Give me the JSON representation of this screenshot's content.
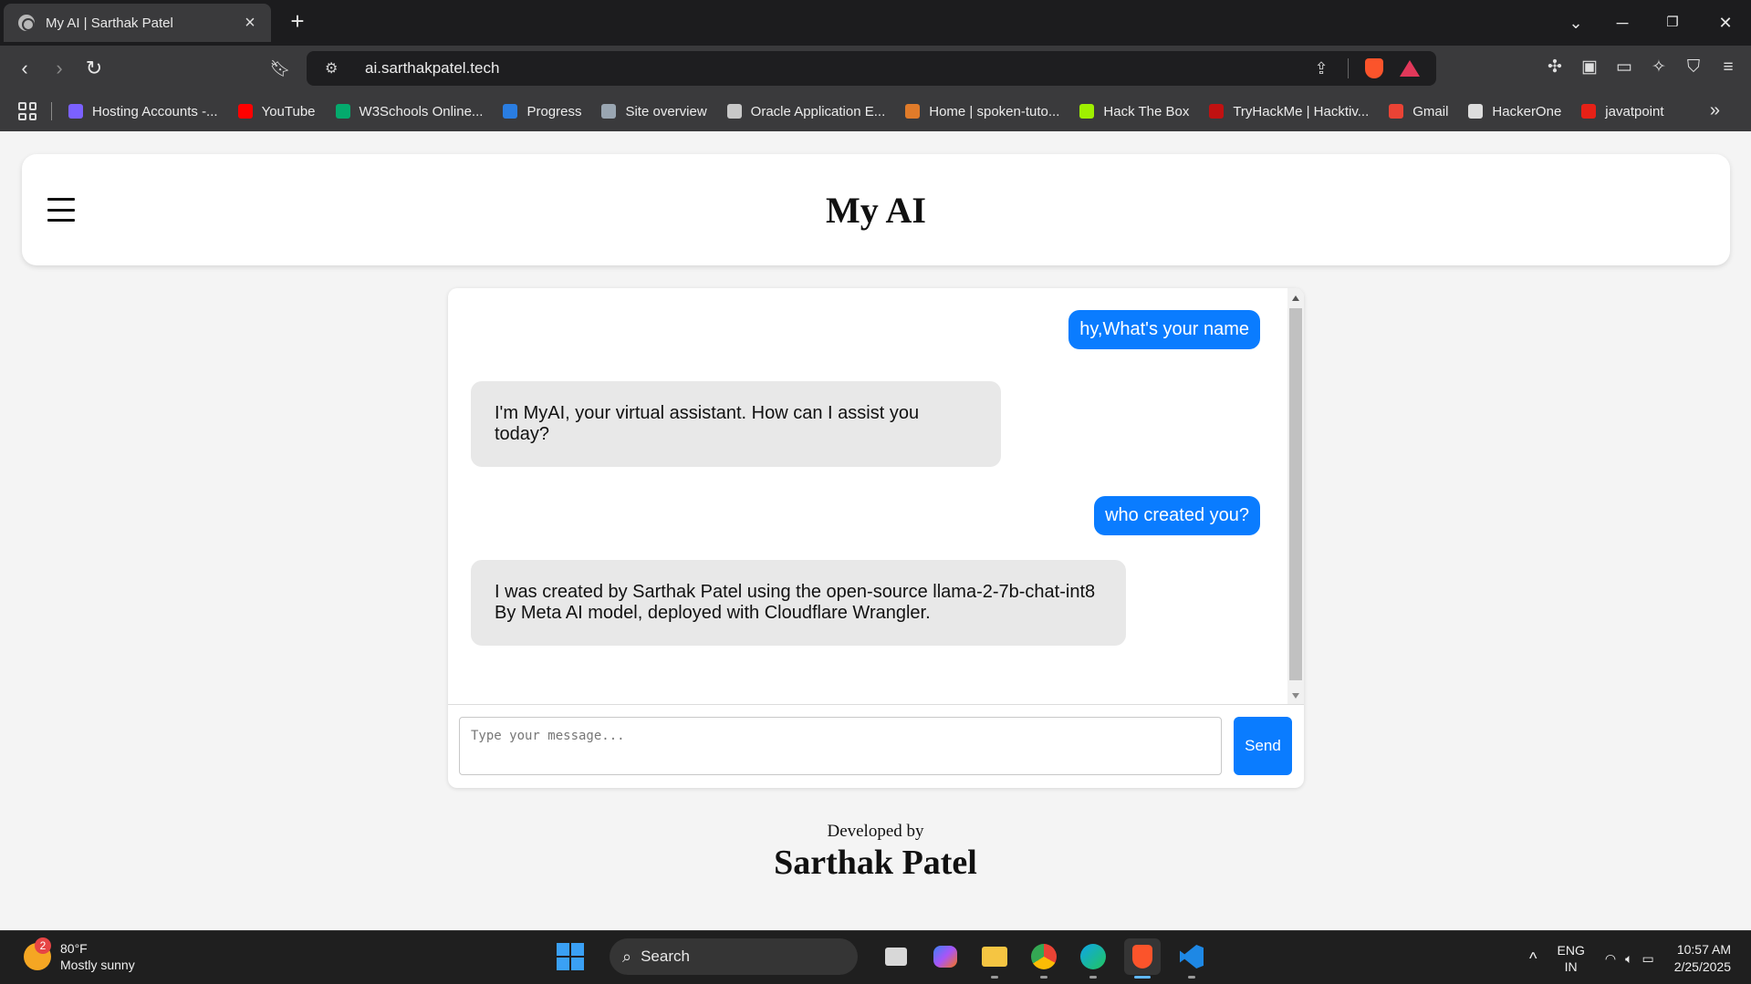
{
  "browser": {
    "tab_title": "My AI | Sarthak Patel",
    "url": "ai.sarthakpatel.tech",
    "bookmarks": [
      {
        "label": "Hosting Accounts -...",
        "color": "#7b61ff"
      },
      {
        "label": "YouTube",
        "color": "#ff0000"
      },
      {
        "label": "W3Schools Online...",
        "color": "#04aa6d"
      },
      {
        "label": "Progress",
        "color": "#2a7de1"
      },
      {
        "label": "Site overview",
        "color": "#9aa6b2"
      },
      {
        "label": "Oracle Application E...",
        "color": "#c8c8c8"
      },
      {
        "label": "Home | spoken-tuto...",
        "color": "#e07b2a"
      },
      {
        "label": "Hack The Box",
        "color": "#9fef00"
      },
      {
        "label": "TryHackMe | Hacktiv...",
        "color": "#c11111"
      },
      {
        "label": "Gmail",
        "color": "#ea4335"
      },
      {
        "label": "HackerOne",
        "color": "#dddddd"
      },
      {
        "label": "javatpoint",
        "color": "#e62117"
      }
    ]
  },
  "header": {
    "title": "My AI"
  },
  "chat": {
    "messages": [
      {
        "role": "user",
        "text": "hy,What's your name"
      },
      {
        "role": "bot",
        "text": "I'm MyAI, your virtual assistant. How can I assist you today?"
      },
      {
        "role": "user",
        "text": "who created you?"
      },
      {
        "role": "bot",
        "text": "I was created by Sarthak Patel using the open-source llama-2-7b-chat-int8 By Meta AI model, deployed with Cloudflare Wrangler."
      }
    ],
    "input_placeholder": "Type your message...",
    "send_label": "Send"
  },
  "footer": {
    "developed_by": "Developed by",
    "developer": "Sarthak Patel"
  },
  "taskbar": {
    "weather_badge": "2",
    "temperature": "80°F",
    "condition": "Mostly sunny",
    "search_label": "Search",
    "language_top": "ENG",
    "language_bottom": "IN",
    "time": "10:57 AM",
    "date": "2/25/2025"
  },
  "colors": {
    "accent": "#0a7cff",
    "bot_bubble": "#e8e8e8",
    "page_bg": "#f4f4f4"
  }
}
